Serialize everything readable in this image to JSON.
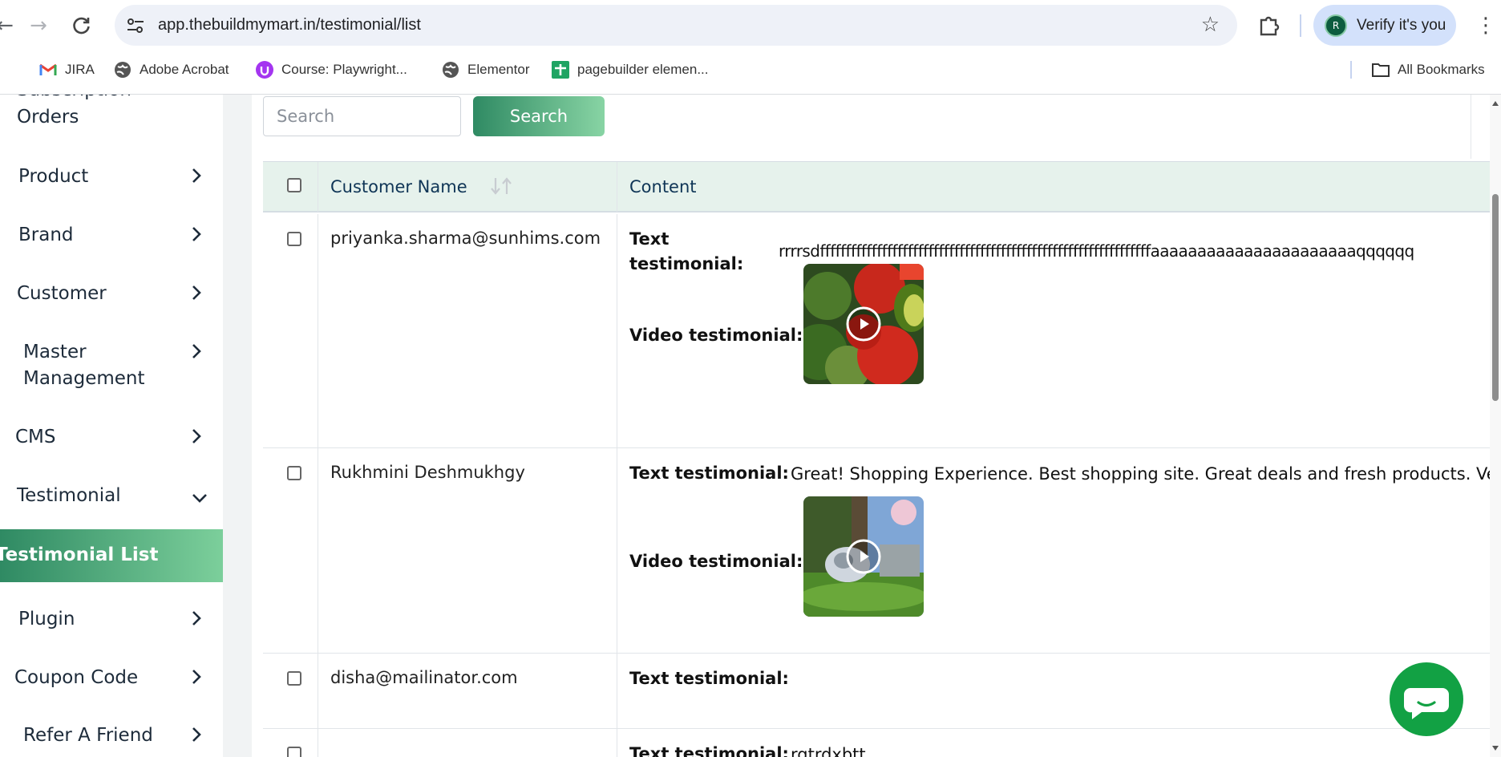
{
  "browser": {
    "url": "app.thebuildmymart.in/testimonial/list",
    "verify_label": "Verify it's you",
    "avatar_letter": "R",
    "bookmarks": [
      "JIRA",
      "Adobe Acrobat",
      "Course: Playwright...",
      "Elementor",
      "pagebuilder elemen..."
    ],
    "all_bookmarks": "All Bookmarks"
  },
  "sidebar": {
    "partial_label": "Subscription",
    "items": [
      {
        "label": "Orders",
        "icon": "none"
      },
      {
        "label": "Product",
        "icon": "chevron-right-icon"
      },
      {
        "label": "Brand",
        "icon": "chevron-right-icon"
      },
      {
        "label": "Customer",
        "icon": "chevron-right-icon"
      },
      {
        "label": "Master Management",
        "icon": "chevron-right-icon"
      },
      {
        "label": "CMS",
        "icon": "chevron-right-icon"
      },
      {
        "label": "Testimonial",
        "icon": "chevron-down-icon"
      },
      {
        "label": "Testimonial List",
        "icon": "none"
      },
      {
        "label": "Plugin",
        "icon": "chevron-right-icon"
      },
      {
        "label": "Coupon Code",
        "icon": "chevron-right-icon"
      },
      {
        "label": "Refer A Friend",
        "icon": "chevron-right-icon"
      }
    ]
  },
  "search": {
    "placeholder": "Search",
    "button_label": "Search"
  },
  "table": {
    "columns": [
      "Customer Name",
      "Content"
    ],
    "text_label": "Text testimonial:",
    "video_label": "Video testimonial:",
    "rows": [
      {
        "customer": "priyanka.sharma@sunhims.com",
        "text": "rrrrsdffffffffffffffffffffffffffffffffffffffffffffffffffffffffffffffffaaaaaaaaaaaaaaaaaaaaaaqqqqqq",
        "has_video": true,
        "video_thumb": "vegetables"
      },
      {
        "customer": "Rukhmini Deshmukhgy",
        "text": "Great! Shopping Experience. Best shopping site. Great deals and fresh products. Very",
        "has_video": true,
        "video_thumb": "animated-rabbit"
      },
      {
        "customer": "disha@mailinator.com",
        "text": "",
        "has_video": false
      },
      {
        "customer": "",
        "text": "rqtrdxbtt",
        "has_video": false
      }
    ]
  },
  "colors": {
    "accent_start": "#2f8a63",
    "accent_end": "#88d4a4",
    "header_bg": "#e6f2ec",
    "chat": "#12a144"
  }
}
